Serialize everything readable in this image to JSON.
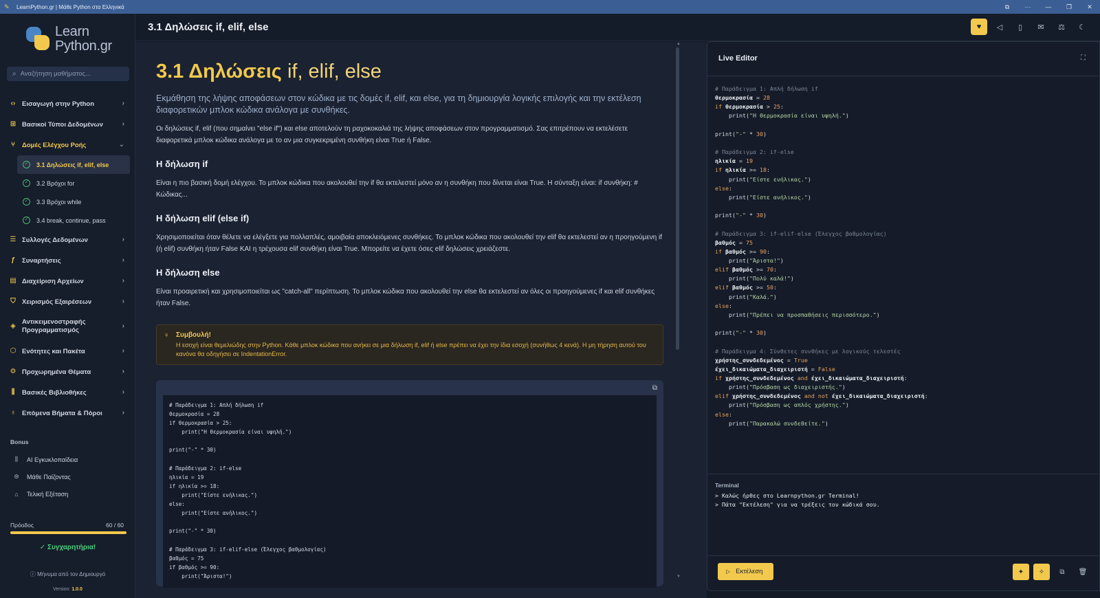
{
  "window": {
    "title": "LearnPython.gr | Μάθε Python στα Ελληνικά"
  },
  "sidebar": {
    "logo_line1": "Learn",
    "logo_line2": "Python.gr",
    "search_placeholder": "Αναζήτηση μαθήματος...",
    "items": [
      {
        "label": "Εισαγωγή στην Python",
        "icon": "code-icon"
      },
      {
        "label": "Βασικοί Τύποι Δεδομένων",
        "icon": "data-types-icon"
      },
      {
        "label": "Δομές Ελέγχου Ροής",
        "icon": "branch-icon",
        "open": true
      },
      {
        "label": "Συλλογές Δεδομένων",
        "icon": "list-icon"
      },
      {
        "label": "Συναρτήσεις",
        "icon": "function-icon"
      },
      {
        "label": "Διαχείριση Αρχείων",
        "icon": "file-icon"
      },
      {
        "label": "Χειρισμός Εξαιρέσεων",
        "icon": "shield-icon"
      },
      {
        "label": "Αντικειμενοστραφής Προγραμματισμός",
        "icon": "object-icon"
      },
      {
        "label": "Ενότητες και Πακέτα",
        "icon": "package-icon"
      },
      {
        "label": "Προχωρημένα Θέματα",
        "icon": "gear-icon"
      },
      {
        "label": "Βασικές Βιβλιοθήκες",
        "icon": "library-icon"
      },
      {
        "label": "Επόμενα Βήματα & Πόροι",
        "icon": "award-icon"
      }
    ],
    "sub_items": [
      {
        "label": "3.1 Δηλώσεις if, elif, else",
        "active": true
      },
      {
        "label": "3.2 Βρόχοι for"
      },
      {
        "label": "3.3 Βρόχοι while"
      },
      {
        "label": "3.4 break, continue, pass"
      }
    ],
    "bonus_title": "Bonus",
    "bonus_items": [
      {
        "label": "AI Εγκυκλοπαίδεια",
        "icon": "library-icon"
      },
      {
        "label": "Μάθε Παίζοντας",
        "icon": "gamepad-icon"
      },
      {
        "label": "Τελική Εξέταση",
        "icon": "graduation-cap-icon"
      }
    ],
    "progress_label": "Πρόοδος",
    "progress_count": "60 / 60",
    "progress_fraction": 1.0,
    "congrats": "Συγχαρητήρια!",
    "creator_message": "Μήνυμα από τον Δημιουργό",
    "version_label": "Version:",
    "version_value": "1.0.0"
  },
  "header": {
    "title": "3.1 Δηλώσεις if, elif, else"
  },
  "article": {
    "title_bold": "3.1 Δηλώσεις",
    "title_rest": "if, elif, else",
    "lead": "Εκμάθηση της λήψης αποφάσεων στον κώδικα με τις δομές if, elif, και else, για τη δημιουργία λογικής επιλογής και την εκτέλεση διαφορετικών μπλοκ κώδικα ανάλογα με συνθήκες.",
    "intro": "Οι δηλώσεις if, elif (που σημαίνει \"else if\") και else αποτελούν τη ραχοκοκαλιά της λήψης αποφάσεων στον προγραμματισμό. Σας επιτρέπουν να εκτελέσετε διαφορετικά μπλοκ κώδικα ανάλογα με το αν μια συγκεκριμένη συνθήκη είναι True ή False.",
    "h_if": "Η δήλωση if",
    "p_if": "Είναι η πιο βασική δομή ελέγχου. Το μπλοκ κώδικα που ακολουθεί την if θα εκτελεστεί μόνο αν η συνθήκη που δίνεται είναι True. Η σύνταξη είναι: if συνθήκη: # Κώδικας...",
    "h_elif": "Η δήλωση elif (else if)",
    "p_elif": "Χρησιμοποιείται όταν θέλετε να ελέγξετε για πολλαπλές, αμοιβαία αποκλειόμενες συνθήκες. Το μπλοκ κώδικα που ακολουθεί την elif θα εκτελεστεί αν η προηγούμενη if (ή elif) συνθήκη ήταν False ΚΑΙ η τρέχουσα elif συνθήκη είναι True. Μπορείτε να έχετε όσες elif δηλώσεις χρειάζεστε.",
    "h_else": "Η δήλωση else",
    "p_else": "Είναι προαιρετική και χρησιμοποιείται ως \"catch-all\" περίπτωση. Το μπλοκ κώδικα που ακολουθεί την else θα εκτελεστεί αν όλες οι προηγούμενες if και elif συνθήκες ήταν False.",
    "tip_title": "Συμβουλή!",
    "tip_text": "Η εσοχή είναι θεμελιώδης στην Python. Κάθε μπλοκ κώδικα που ανήκει σε μια δήλωση if, elif ή else πρέπει να έχει την ίδια εσοχή (συνήθως 4 κενά). Η μη τήρηση αυτού του κανόνα θα οδηγήσει σε IndentationError.",
    "code": "# Παράδειγμα 1: Απλή δήλωση if\nθερμοκρασία = 28\nif θερμοκρασία > 25:\n    print(\"Η θερμοκρασία είναι υψηλή.\")\n\nprint(\"-\" * 30)\n\n# Παράδειγμα 2: if-else\nηλικία = 19\nif ηλικία >= 18:\n    print(\"Είστε ενήλικας.\")\nelse:\n    print(\"Είστε ανήλικος.\")\n\nprint(\"-\" * 30)\n\n# Παράδειγμα 3: if-elif-else (Έλεγχος βαθμολογίας)\nβαθμός = 75\nif βαθμός >= 90:\n    print(\"Άριστα!\")"
  },
  "editor": {
    "title": "Live Editor",
    "terminal_title": "Terminal",
    "terminal_lines": [
      "> Καλώς ήρθες στο Learnpython.gr Terminal!",
      "> Πάτα \"Εκτέλεση\" για να τρέξεις τον κώδικά σου."
    ],
    "run_label": "Εκτέλεση"
  },
  "colors": {
    "accent": "#f2c94c",
    "success": "#4dd07a",
    "background": "#1b2232",
    "sidebar": "#161d2b"
  }
}
